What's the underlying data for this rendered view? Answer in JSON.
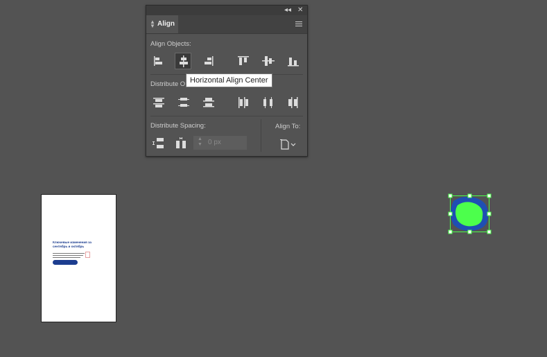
{
  "panel": {
    "title": "Align",
    "align_objects_label": "Align Objects:",
    "distribute_objects_label": "Distribute O",
    "distribute_spacing_label": "Distribute Spacing:",
    "align_to_label": "Align To:",
    "spacing_value_placeholder": "0 px",
    "collapse_glyph": "◂◂",
    "close_glyph": "✕",
    "icons": {
      "align": [
        "horizontal-align-left-icon",
        "horizontal-align-center-icon",
        "horizontal-align-right-icon",
        "vertical-align-top-icon",
        "vertical-align-center-icon",
        "vertical-align-bottom-icon"
      ],
      "distribute": [
        "vertical-distribute-top-icon",
        "vertical-distribute-center-icon",
        "vertical-distribute-bottom-icon",
        "horizontal-distribute-left-icon",
        "horizontal-distribute-center-icon",
        "horizontal-distribute-right-icon"
      ],
      "spacing": [
        "vertical-distribute-space-icon",
        "horizontal-distribute-space-icon"
      ],
      "align_to": "align-to-artboard-icon"
    },
    "selected_button": "horizontal-align-center"
  },
  "tooltip": {
    "text": "Horizontal Align Center"
  },
  "artboard": {
    "heading": "Ключевые изменения за сентябрь и октябрь"
  },
  "colors": {
    "canvas": "#535353",
    "panel": "#535353",
    "artboard_accent": "#1c3d8f",
    "selection": "#4cff4c",
    "object_fill": "#1f4fb3"
  }
}
